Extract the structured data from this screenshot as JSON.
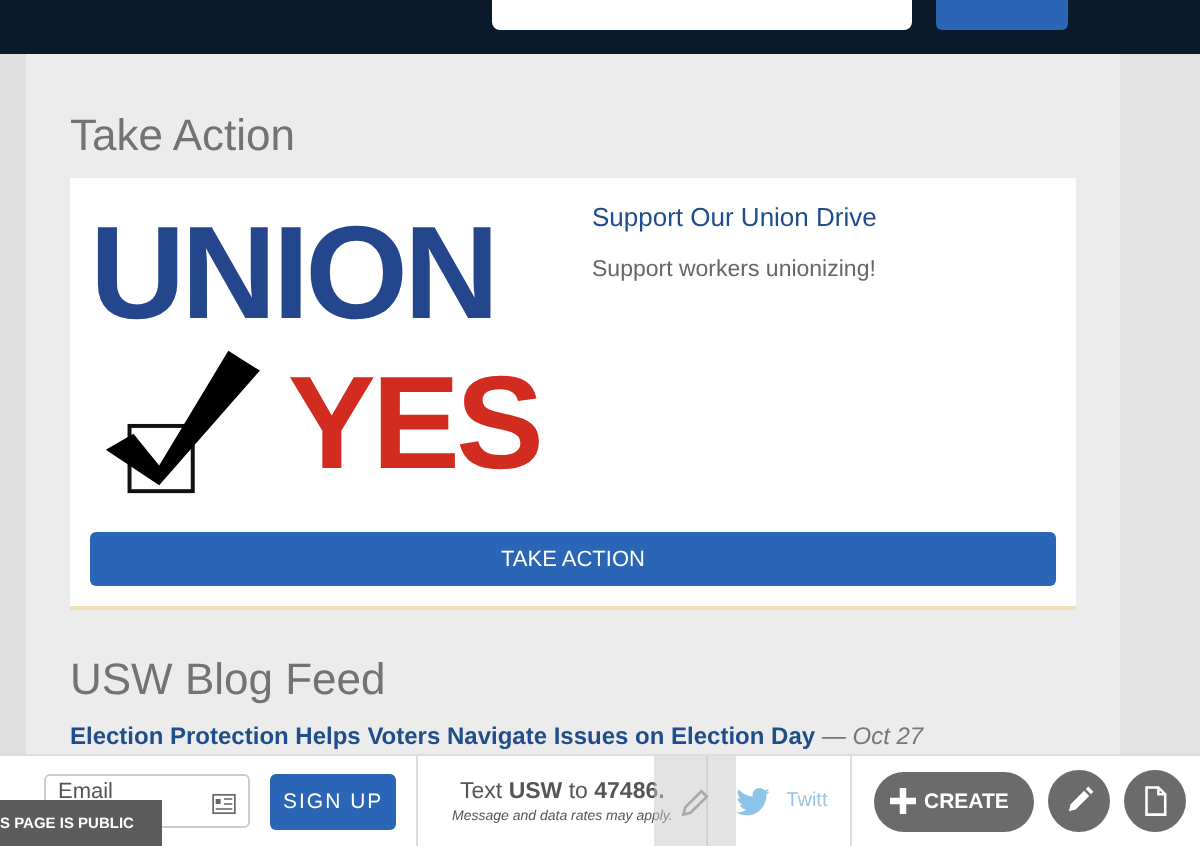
{
  "take_action": {
    "heading": "Take Action",
    "card": {
      "logo_words": [
        "UNION",
        "YES"
      ],
      "title": "Support Our Union Drive",
      "description": "Support workers unionizing!",
      "button": "TAKE ACTION"
    }
  },
  "blog": {
    "heading": "USW Blog Feed",
    "posts": [
      {
        "title": "Election Protection Helps Voters Navigate Issues on Election Day",
        "date": "— Oct 27"
      }
    ]
  },
  "footer_bar": {
    "email_placeholder": "Email",
    "signup": "SIGN UP",
    "sms": "Text **USW** to **47486.**",
    "sms_note": "Message and data rates may apply.",
    "twitter": "Twitt",
    "create": "CREATE",
    "public_badge": "S PAGE IS PUBLIC"
  }
}
